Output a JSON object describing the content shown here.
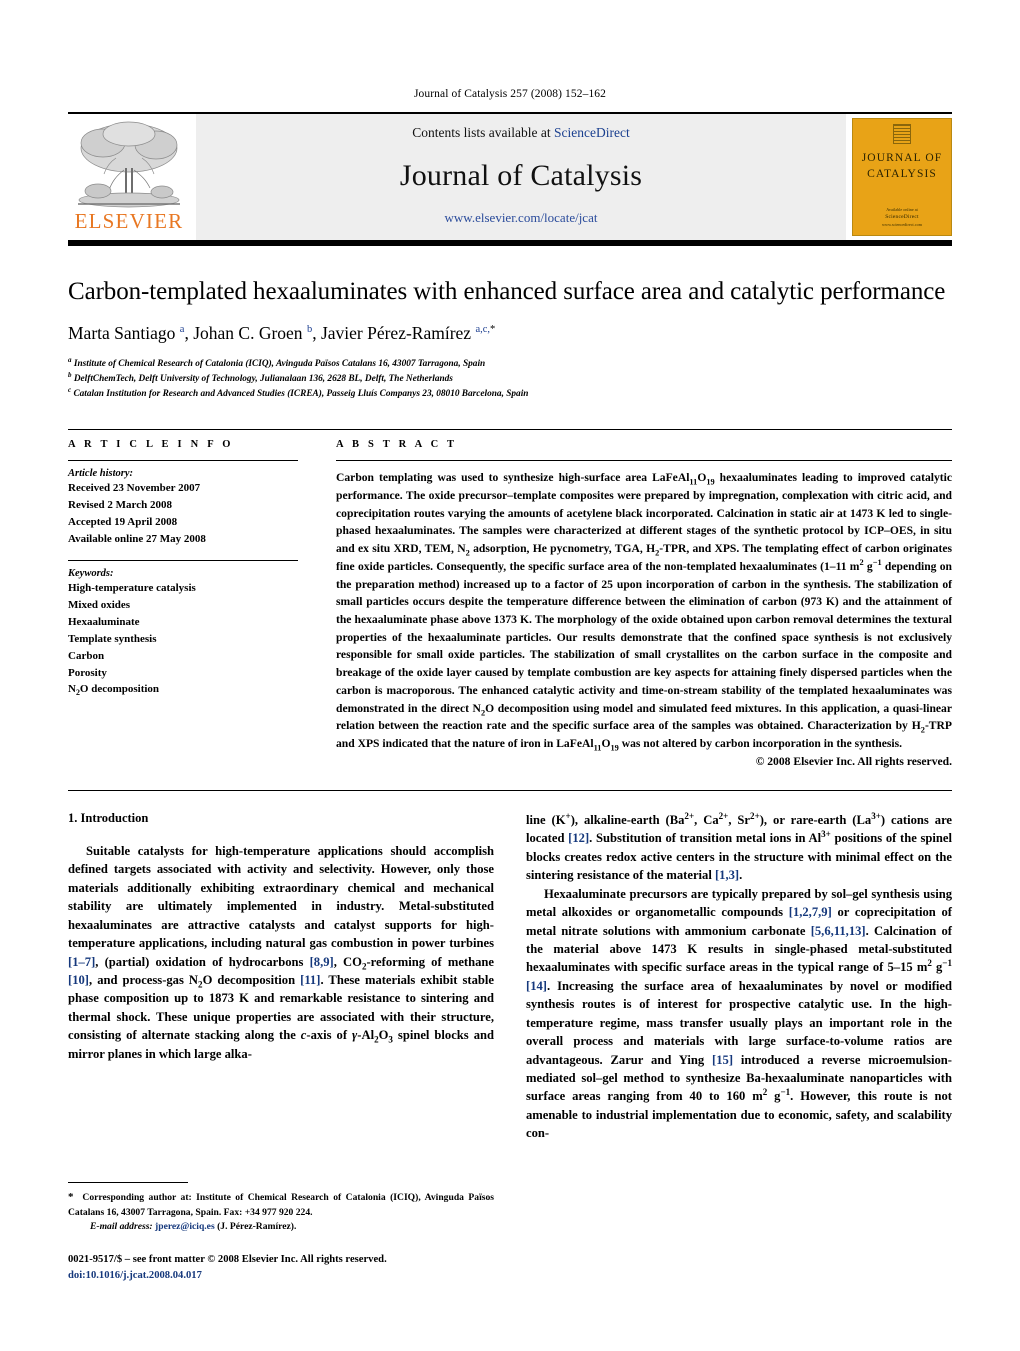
{
  "running_head": "Journal of Catalysis 257 (2008) 152–162",
  "masthead": {
    "publisher_name": "ELSEVIER",
    "contents_prefix": "Contents lists available at ",
    "contents_link": "ScienceDirect",
    "journal_name": "Journal of Catalysis",
    "journal_url": "www.elsevier.com/locate/jcat",
    "cover_line1": "JOURNAL OF",
    "cover_line2": "CATALYSIS",
    "cover_footer_small": "Available online at",
    "cover_sciencedirect": "ScienceDirect",
    "cover_footer_tiny": "www.sciencedirect.com"
  },
  "article": {
    "title": "Carbon-templated hexaaluminates with enhanced surface area and catalytic performance",
    "authors_html": "Marta Santiago <sup>a</sup>, Johan C. Groen <sup>b</sup>, Javier Pérez-Ramírez <sup>a,c,</sup><sup class=\"star\">*</sup>",
    "affiliations": [
      "Institute of Chemical Research of Catalonia (ICIQ), Avinguda Països Catalans 16, 43007 Tarragona, Spain",
      "DelftChemTech, Delft University of Technology, Julianalaan 136, 2628 BL, Delft, The Netherlands",
      "Catalan Institution for Research and Advanced Studies (ICREA), Passeig Lluís Companys 23, 08010 Barcelona, Spain"
    ],
    "affiliation_marks": [
      "a",
      "b",
      "c"
    ]
  },
  "article_info": {
    "heading": "A R T I C L E    I N F O",
    "history_heading": "Article history:",
    "history": [
      "Received 23 November 2007",
      "Revised 2 March 2008",
      "Accepted 19 April 2008",
      "Available online 27 May 2008"
    ],
    "keywords_heading": "Keywords:",
    "keywords": [
      "High-temperature catalysis",
      "Mixed oxides",
      "Hexaaluminate",
      "Template synthesis",
      "Carbon",
      "Porosity",
      "N2O decomposition"
    ]
  },
  "abstract": {
    "heading": "A B S T R A C T",
    "text_html": "Carbon templating was used to synthesize high-surface area LaFeAl<sub>11</sub>O<sub>19</sub> hexaaluminates leading to improved catalytic performance. The oxide precursor–template composites were prepared by impregnation, complexation with citric acid, and coprecipitation routes varying the amounts of acetylene black incorporated. Calcination in static air at 1473 K led to single-phased hexaaluminates. The samples were characterized at different stages of the synthetic protocol by ICP–OES, in situ and ex situ XRD, TEM, N<sub>2</sub> adsorption, He pycnometry, TGA, H<sub>2</sub>-TPR, and XPS. The templating effect of carbon originates fine oxide particles. Consequently, the specific surface area of the non-templated hexaaluminates (1–11 m<sup>2</sup> g<sup>−1</sup> depending on the preparation method) increased up to a factor of 25 upon incorporation of carbon in the synthesis. The stabilization of small particles occurs despite the temperature difference between the elimination of carbon (973 K) and the attainment of the hexaaluminate phase above 1373 K. The morphology of the oxide obtained upon carbon removal determines the textural properties of the hexaaluminate particles. Our results demonstrate that the confined space synthesis is not exclusively responsible for small oxide particles. The stabilization of small crystallites on the carbon surface in the composite and breakage of the oxide layer caused by template combustion are key aspects for attaining finely dispersed particles when the carbon is macroporous. The enhanced catalytic activity and time-on-stream stability of the templated hexaaluminates was demonstrated in the direct N<sub>2</sub>O decomposition using model and simulated feed mixtures. In this application, a quasi-linear relation between the reaction rate and the specific surface area of the samples was obtained. Characterization by H<sub>2</sub>-TRP and XPS indicated that the nature of iron in LaFeAl<sub>11</sub>O<sub>19</sub> was not altered by carbon incorporation in the synthesis.",
    "copyright": "© 2008 Elsevier Inc. All rights reserved."
  },
  "body": {
    "section_heading": "1. Introduction",
    "left_paragraphs_html": [
      "Suitable catalysts for high-temperature applications should accomplish defined targets associated with activity and selectivity. However, only those materials additionally exhibiting extraordinary chemical and mechanical stability are ultimately implemented in industry. Metal-substituted hexaaluminates are attractive catalysts and catalyst supports for high-temperature applications, including natural gas combustion in power turbines <span class=\"ref\">[1–7]</span>, (partial) oxidation of hydrocarbons <span class=\"ref\">[8,9]</span>, CO<sub>2</sub>-reforming of methane <span class=\"ref\">[10]</span>, and process-gas N<sub>2</sub>O decomposition <span class=\"ref\">[11]</span>. These materials exhibit stable phase composition up to 1873 K and remarkable resistance to sintering and thermal shock. These unique properties are associated with their structure, consisting of alternate stacking along the <i>c</i>-axis of <i>γ</i>-Al<sub>2</sub>O<sub>3</sub> spinel blocks and mirror planes in which large alka-"
    ],
    "right_paragraphs_html": [
      "line (K<sup>+</sup>), alkaline-earth (Ba<sup>2+</sup>, Ca<sup>2+</sup>, Sr<sup>2+</sup>), or rare-earth (La<sup>3+</sup>) cations are located <span class=\"ref\">[12]</span>. Substitution of transition metal ions in Al<sup>3+</sup> positions of the spinel blocks creates redox active centers in the structure with minimal effect on the sintering resistance of the material <span class=\"ref\">[1,3]</span>.",
      "Hexaaluminate precursors are typically prepared by sol–gel synthesis using metal alkoxides or organometallic compounds <span class=\"ref\">[1,2,7,9]</span> or coprecipitation of metal nitrate solutions with ammonium carbonate <span class=\"ref\">[5,6,11,13]</span>. Calcination of the material above 1473 K results in single-phased metal-substituted hexaaluminates with specific surface areas in the typical range of 5–15 m<sup>2</sup> g<sup>−1</sup> <span class=\"ref\">[14]</span>. Increasing the surface area of hexaaluminates by novel or modified synthesis routes is of interest for prospective catalytic use. In the high-temperature regime, mass transfer usually plays an important role in the overall process and materials with large surface-to-volume ratios are advantageous. Zarur and Ying <span class=\"ref\">[15]</span> introduced a reverse microemulsion-mediated sol–gel method to synthesize Ba-hexaaluminate nanoparticles with surface areas ranging from 40 to 160 m<sup>2</sup> g<sup>−1</sup>. However, this route is not amenable to industrial implementation due to economic, safety, and scalability con-"
    ]
  },
  "footnote": {
    "corresponding_html": "<span style=\"font-size:11px\">*</span>&nbsp; Corresponding author at: Institute of Chemical Research of Catalonia (ICIQ), Avinguda Països Catalans 16, 43007 Tarragona, Spain. Fax: +34 977 920 224.",
    "email_label": "E-mail address:",
    "email": "jperez@iciq.es",
    "email_owner": "(J. Pérez-Ramírez).",
    "issn_line": "0021-9517/$ – see front matter  © 2008 Elsevier Inc. All rights reserved.",
    "doi": "doi:10.1016/j.jcat.2008.04.017"
  }
}
